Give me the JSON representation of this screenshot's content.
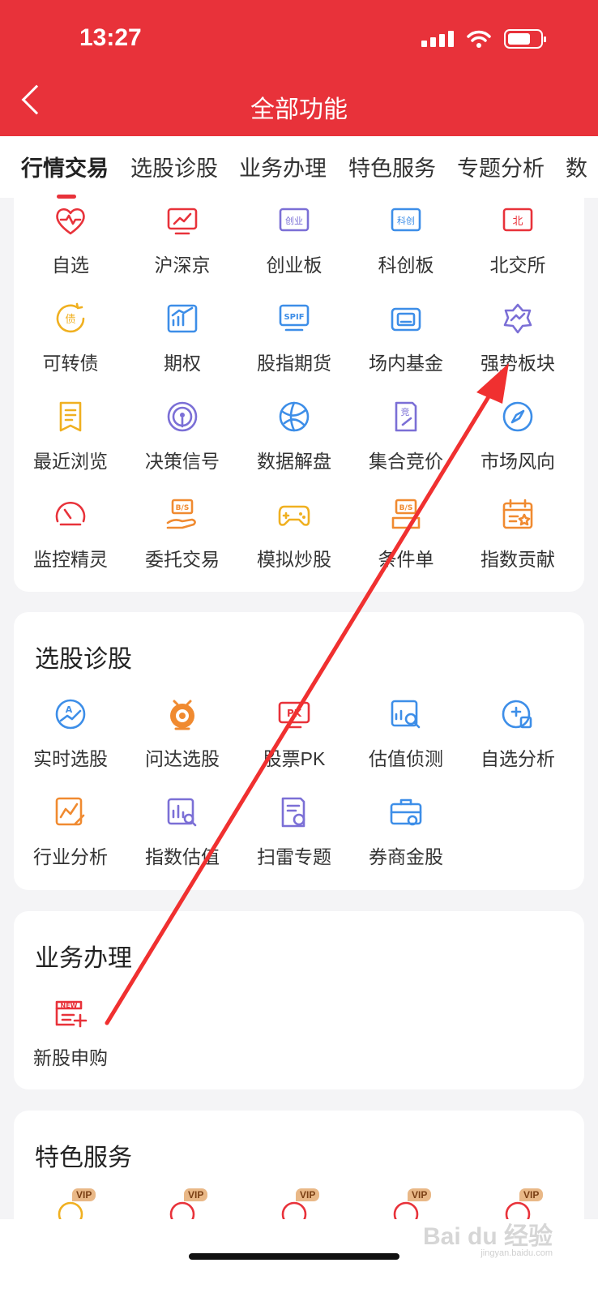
{
  "status": {
    "time": "13:27"
  },
  "header": {
    "title": "全部功能"
  },
  "tabs": [
    "行情交易",
    "选股诊股",
    "业务办理",
    "特色服务",
    "专题分析",
    "数"
  ],
  "section1": {
    "items": [
      {
        "label": "自选",
        "icon": "heart-chart-icon",
        "color": "#e8323a"
      },
      {
        "label": "沪深京",
        "icon": "monitor-chart-icon",
        "color": "#e8323a"
      },
      {
        "label": "创业板",
        "icon": "chuangye-board-icon",
        "color": "#7b6fd6"
      },
      {
        "label": "科创板",
        "icon": "kechuang-board-icon",
        "color": "#3d8ee8"
      },
      {
        "label": "北交所",
        "icon": "beijing-exchange-icon",
        "color": "#e8323a"
      },
      {
        "label": "可转债",
        "icon": "bond-coin-icon",
        "color": "#f0b020"
      },
      {
        "label": "期权",
        "icon": "option-chart-icon",
        "color": "#3d8ee8"
      },
      {
        "label": "股指期货",
        "icon": "spif-icon",
        "color": "#3d8ee8"
      },
      {
        "label": "场内基金",
        "icon": "fund-icon",
        "color": "#3d8ee8"
      },
      {
        "label": "强势板块",
        "icon": "strong-sector-icon",
        "color": "#7b6fd6"
      },
      {
        "label": "最近浏览",
        "icon": "document-icon",
        "color": "#f0b020"
      },
      {
        "label": "决策信号",
        "icon": "signal-radar-icon",
        "color": "#7b6fd6"
      },
      {
        "label": "数据解盘",
        "icon": "globe-network-icon",
        "color": "#3d8ee8"
      },
      {
        "label": "集合竞价",
        "icon": "auction-icon",
        "color": "#7b6fd6"
      },
      {
        "label": "市场风向",
        "icon": "compass-icon",
        "color": "#3d8ee8"
      },
      {
        "label": "监控精灵",
        "icon": "speedometer-icon",
        "color": "#e8323a"
      },
      {
        "label": "委托交易",
        "icon": "bs-hand-icon",
        "color": "#f08a30"
      },
      {
        "label": "模拟炒股",
        "icon": "gamepad-icon",
        "color": "#f0b020"
      },
      {
        "label": "条件单",
        "icon": "bs-order-icon",
        "color": "#f08a30"
      },
      {
        "label": "指数贡献",
        "icon": "calendar-star-icon",
        "color": "#f08a30"
      }
    ]
  },
  "section2": {
    "title": "选股诊股",
    "items": [
      {
        "label": "实时选股",
        "icon": "ai-chart-icon",
        "color": "#3d8ee8"
      },
      {
        "label": "问达选股",
        "icon": "robot-icon",
        "color": "#f08a30"
      },
      {
        "label": "股票PK",
        "icon": "pk-monitor-icon",
        "color": "#e8323a"
      },
      {
        "label": "估值侦测",
        "icon": "chart-search-icon",
        "color": "#3d8ee8"
      },
      {
        "label": "自选分析",
        "icon": "plus-chart-icon",
        "color": "#3d8ee8"
      },
      {
        "label": "行业分析",
        "icon": "line-pen-icon",
        "color": "#f08a30"
      },
      {
        "label": "指数估值",
        "icon": "bar-search-icon",
        "color": "#7b6fd6"
      },
      {
        "label": "扫雷专题",
        "icon": "mine-doc-icon",
        "color": "#7b6fd6"
      },
      {
        "label": "券商金股",
        "icon": "briefcase-icon",
        "color": "#3d8ee8"
      }
    ]
  },
  "section3": {
    "title": "业务办理",
    "items": [
      {
        "label": "新股申购",
        "icon": "new-stock-icon",
        "color": "#e8323a"
      }
    ]
  },
  "section4": {
    "title": "特色服务",
    "vip": "VIP"
  },
  "watermark": {
    "text": "Bai du 经验",
    "url": "jingyan.baidu.com"
  }
}
